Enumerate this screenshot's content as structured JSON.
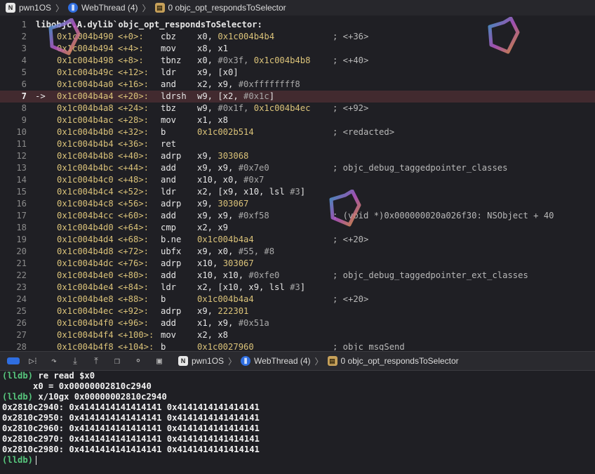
{
  "jumpbar": {
    "items": [
      {
        "label": "pwn1OS",
        "icon": "app-icon"
      },
      {
        "label": "WebThread (4)",
        "icon": "thread-icon"
      },
      {
        "label": "0 objc_opt_respondsToSelector",
        "icon": "stack-frame-icon"
      }
    ]
  },
  "code": {
    "header": "libobjc.A.dylib`objc_opt_respondsToSelector:",
    "lines": [
      {
        "n": "1"
      },
      {
        "n": "2",
        "addr": "0x1c004b490",
        "off": "<+0>:",
        "mn": "cbz",
        "ops": "x0, ",
        "lit": "0x1c004b4b4",
        "cm": "; <+36>"
      },
      {
        "n": "3",
        "addr": "0x1c004b494",
        "off": "<+4>:",
        "mn": "mov",
        "ops": "x8, x1"
      },
      {
        "n": "4",
        "addr": "0x1c004b498",
        "off": "<+8>:",
        "mn": "tbnz",
        "ops": "x0, ",
        "imm": "#0x3f, ",
        "lit": "0x1c004b4b8",
        "cm": "; <+40>"
      },
      {
        "n": "5",
        "addr": "0x1c004b49c",
        "off": "<+12>:",
        "mn": "ldr",
        "ops": "x9, [x0]"
      },
      {
        "n": "6",
        "addr": "0x1c004b4a0",
        "off": "<+16>:",
        "mn": "and",
        "ops": "x2, x9, ",
        "imm": "#0xffffffff8"
      },
      {
        "n": "7",
        "arrow": "->",
        "addr": "0x1c004b4a4",
        "off": "<+20>:",
        "mn": "ldrsh",
        "ops": "w9, [x2, ",
        "imm": "#0x1c",
        "tail": "]",
        "current": true
      },
      {
        "n": "8",
        "addr": "0x1c004b4a8",
        "off": "<+24>:",
        "mn": "tbz",
        "ops": "w9, ",
        "imm": "#0x1f, ",
        "lit": "0x1c004b4ec",
        "cm": "; <+92>"
      },
      {
        "n": "9",
        "addr": "0x1c004b4ac",
        "off": "<+28>:",
        "mn": "mov",
        "ops": "x1, x8"
      },
      {
        "n": "10",
        "addr": "0x1c004b4b0",
        "off": "<+32>:",
        "mn": "b",
        "lit": "0x1c002b514",
        "cm": "; <redacted>"
      },
      {
        "n": "11",
        "addr": "0x1c004b4b4",
        "off": "<+36>:",
        "mn": "ret"
      },
      {
        "n": "12",
        "addr": "0x1c004b4b8",
        "off": "<+40>:",
        "mn": "adrp",
        "ops": "x9, ",
        "lit": "303068"
      },
      {
        "n": "13",
        "addr": "0x1c004b4bc",
        "off": "<+44>:",
        "mn": "add",
        "ops": "x9, x9, ",
        "imm": "#0x7e0",
        "cm": "; objc_debug_taggedpointer_classes"
      },
      {
        "n": "14",
        "addr": "0x1c004b4c0",
        "off": "<+48>:",
        "mn": "and",
        "ops": "x10, x0, ",
        "imm": "#0x7"
      },
      {
        "n": "15",
        "addr": "0x1c004b4c4",
        "off": "<+52>:",
        "mn": "ldr",
        "ops": "x2, [x9, x10, lsl ",
        "imm": "#3",
        "tail": "]"
      },
      {
        "n": "16",
        "addr": "0x1c004b4c8",
        "off": "<+56>:",
        "mn": "adrp",
        "ops": "x9, ",
        "lit": "303067"
      },
      {
        "n": "17",
        "addr": "0x1c004b4cc",
        "off": "<+60>:",
        "mn": "add",
        "ops": "x9, x9, ",
        "imm": "#0xf58",
        "cm": "; (void *)0x000000020a026f30: NSObject + 40"
      },
      {
        "n": "18",
        "addr": "0x1c004b4d0",
        "off": "<+64>:",
        "mn": "cmp",
        "ops": "x2, x9"
      },
      {
        "n": "19",
        "addr": "0x1c004b4d4",
        "off": "<+68>:",
        "mn": "b.ne",
        "lit": "0x1c004b4a4",
        "cm": "; <+20>"
      },
      {
        "n": "20",
        "addr": "0x1c004b4d8",
        "off": "<+72>:",
        "mn": "ubfx",
        "ops": "x9, x0, ",
        "imm": "#55, #8"
      },
      {
        "n": "21",
        "addr": "0x1c004b4dc",
        "off": "<+76>:",
        "mn": "adrp",
        "ops": "x10, ",
        "lit": "303067"
      },
      {
        "n": "22",
        "addr": "0x1c004b4e0",
        "off": "<+80>:",
        "mn": "add",
        "ops": "x10, x10, ",
        "imm": "#0xfe0",
        "cm": "; objc_debug_taggedpointer_ext_classes"
      },
      {
        "n": "23",
        "addr": "0x1c004b4e4",
        "off": "<+84>:",
        "mn": "ldr",
        "ops": "x2, [x10, x9, lsl ",
        "imm": "#3",
        "tail": "]"
      },
      {
        "n": "24",
        "addr": "0x1c004b4e8",
        "off": "<+88>:",
        "mn": "b",
        "lit": "0x1c004b4a4",
        "cm": "; <+20>"
      },
      {
        "n": "25",
        "addr": "0x1c004b4ec",
        "off": "<+92>:",
        "mn": "adrp",
        "ops": "x9, ",
        "lit": "222301"
      },
      {
        "n": "26",
        "addr": "0x1c004b4f0",
        "off": "<+96>:",
        "mn": "add",
        "ops": "x1, x9, ",
        "imm": "#0x51a"
      },
      {
        "n": "27",
        "addr": "0x1c004b4f4",
        "off": "<+100>:",
        "mn": "mov",
        "ops": "x2, x8"
      },
      {
        "n": "28",
        "addr": "0x1c004b4f8",
        "off": "<+104>:",
        "mn": "b",
        "lit": "0x1c0027960",
        "cm": "; objc_msgSend"
      }
    ]
  },
  "debug_toolbar": {
    "buttons": [
      "breakpoints-toggle-icon",
      "continue-icon",
      "step-over-icon",
      "step-into-icon",
      "step-out-icon",
      "view-hierarchy-icon",
      "memory-graph-icon",
      "environment-overrides-icon"
    ],
    "crumbs": [
      {
        "label": "pwn1OS",
        "icon": "app-icon"
      },
      {
        "label": "WebThread (4)",
        "icon": "thread-icon"
      },
      {
        "label": "0 objc_opt_respondsToSelector",
        "icon": "stack-frame-icon"
      }
    ]
  },
  "console": {
    "lines": [
      {
        "prompt": "(lldb)",
        "text": " re read $x0"
      },
      {
        "text": "      x0 = 0x00000002810c2940"
      },
      {
        "prompt": "(lldb)",
        "text": " x/10gx 0x00000002810c2940"
      },
      {
        "text": "0x2810c2940: 0x4141414141414141 0x4141414141414141"
      },
      {
        "text": "0x2810c2950: 0x4141414141414141 0x4141414141414141"
      },
      {
        "text": "0x2810c2960: 0x4141414141414141 0x4141414141414141"
      },
      {
        "text": "0x2810c2970: 0x4141414141414141 0x4141414141414141"
      },
      {
        "text": "0x2810c2980: 0x4141414141414141 0x4141414141414141"
      },
      {
        "prompt": "(lldb)",
        "text": ""
      }
    ]
  },
  "colors": {
    "address": "#dac279",
    "prompt": "#57c77d",
    "current_line": "#422a2f",
    "accent": "#2f6ee0"
  }
}
